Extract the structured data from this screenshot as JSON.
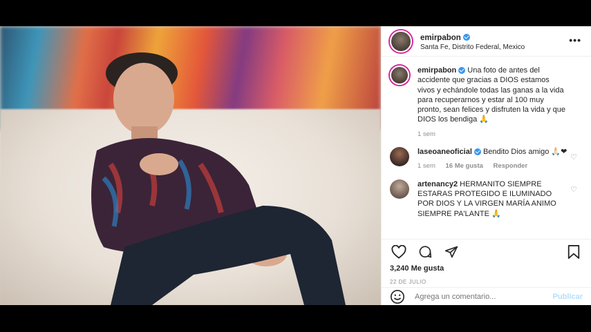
{
  "post": {
    "username": "emirpabon",
    "location": "Santa Fe, Distrito Federal, Mexico",
    "more_label": "•••"
  },
  "caption": {
    "username": "emirpabon",
    "text": "Una foto de antes del accidente que gracias a DIOS estamos vivos y echándole todas las ganas a la vida para recuperarnos y estar al 100 muy pronto, sean felices y disfruten la vida y que DIOS los bendiga 🙏",
    "time": "1 sem"
  },
  "comments": [
    {
      "username": "laseoaneoficial",
      "text": "Bendito Dios amigo 🙏🏻❤",
      "time": "1 sem",
      "likes": "16 Me gusta",
      "reply": "Responder"
    },
    {
      "username": "artenancy2",
      "text": "HERMANITO SIEMPRE ESTARAS PROTEGIDO E ILUMINADO POR DIOS Y LA VIRGEN MARÍA ANIMO SIEMPRE PA'LANTE 🙏"
    }
  ],
  "stats": {
    "likes": "3,240 Me gusta",
    "date": "22 DE JULIO"
  },
  "add_comment": {
    "placeholder": "Agrega un comentario...",
    "post_label": "Publicar"
  },
  "icons": {
    "like": "heart-icon",
    "comment": "comment-icon",
    "share": "share-icon",
    "save": "bookmark-icon",
    "emoji": "emoji-icon"
  },
  "colors": {
    "verified": "#3897f0",
    "muted": "#8e8e8e",
    "post_button": "#b2dffc"
  }
}
